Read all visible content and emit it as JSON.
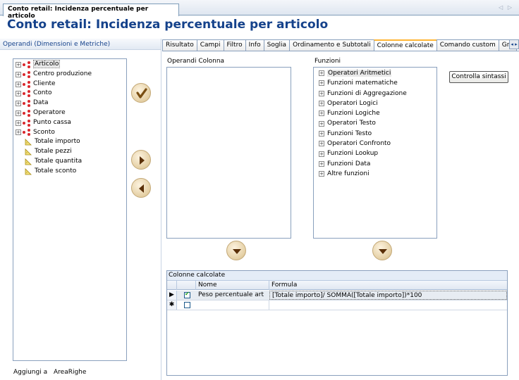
{
  "document_tab": {
    "label": "Conto retail: Incidenza percentuale per articolo",
    "nav_arrows": "◁ ▷"
  },
  "page_title": "Conto retail: Incidenza percentuale per articolo",
  "left_panel": {
    "header": "Operandi (Dimensioni e Metriche)",
    "tree": [
      {
        "label": "Articolo",
        "type": "dimension",
        "selected": true
      },
      {
        "label": "Centro produzione",
        "type": "dimension"
      },
      {
        "label": "Cliente",
        "type": "dimension"
      },
      {
        "label": "Conto",
        "type": "dimension"
      },
      {
        "label": "Data",
        "type": "dimension"
      },
      {
        "label": "Operatore",
        "type": "dimension"
      },
      {
        "label": "Punto cassa",
        "type": "dimension"
      },
      {
        "label": "Sconto",
        "type": "dimension"
      },
      {
        "label": "Totale importo",
        "type": "metric"
      },
      {
        "label": "Totale pezzi",
        "type": "metric"
      },
      {
        "label": "Totale quantita",
        "type": "metric"
      },
      {
        "label": "Totale sconto",
        "type": "metric"
      }
    ],
    "aggiungi_label": "Aggiungi a",
    "aggiungi_value": "AreaRighe"
  },
  "tabs": [
    {
      "label": "Risultato"
    },
    {
      "label": "Campi"
    },
    {
      "label": "Filtro"
    },
    {
      "label": "Info"
    },
    {
      "label": "Soglia"
    },
    {
      "label": "Ordinamento e Subtotali"
    },
    {
      "label": "Colonne calcolate",
      "active": true
    },
    {
      "label": "Comando custom"
    },
    {
      "label": "Gra"
    }
  ],
  "tab_scroll": "◂ ▸",
  "operandi_colonna_label": "Operandi Colonna",
  "funzioni": {
    "label": "Funzioni",
    "items": [
      {
        "label": "Operatori Aritmetici",
        "selected": true
      },
      {
        "label": "Funzioni matematiche"
      },
      {
        "label": "Funzioni di Aggregazione"
      },
      {
        "label": "Operatori Logici"
      },
      {
        "label": "Funzioni Logiche"
      },
      {
        "label": "Operatori Testo"
      },
      {
        "label": "Funzioni Testo"
      },
      {
        "label": "Operatori Confronto"
      },
      {
        "label": "Funzioni Lookup"
      },
      {
        "label": "Funzioni Data"
      },
      {
        "label": "Altre funzioni"
      }
    ]
  },
  "check_syntax_label": "Controlla sintassi",
  "grid": {
    "caption": "Colonne calcolate",
    "columns": [
      "Nome",
      "Formula"
    ],
    "rows": [
      {
        "indicator": "▶",
        "checked": true,
        "nome": "Peso percentuale art",
        "formula": "[Totale importo]/ SOMMA([Totale importo])*100"
      }
    ],
    "new_row_indicator": "✱"
  },
  "colors": {
    "title": "#15428b",
    "accent_tab": "#ffb534",
    "dimension_icon": "#d9262b"
  }
}
